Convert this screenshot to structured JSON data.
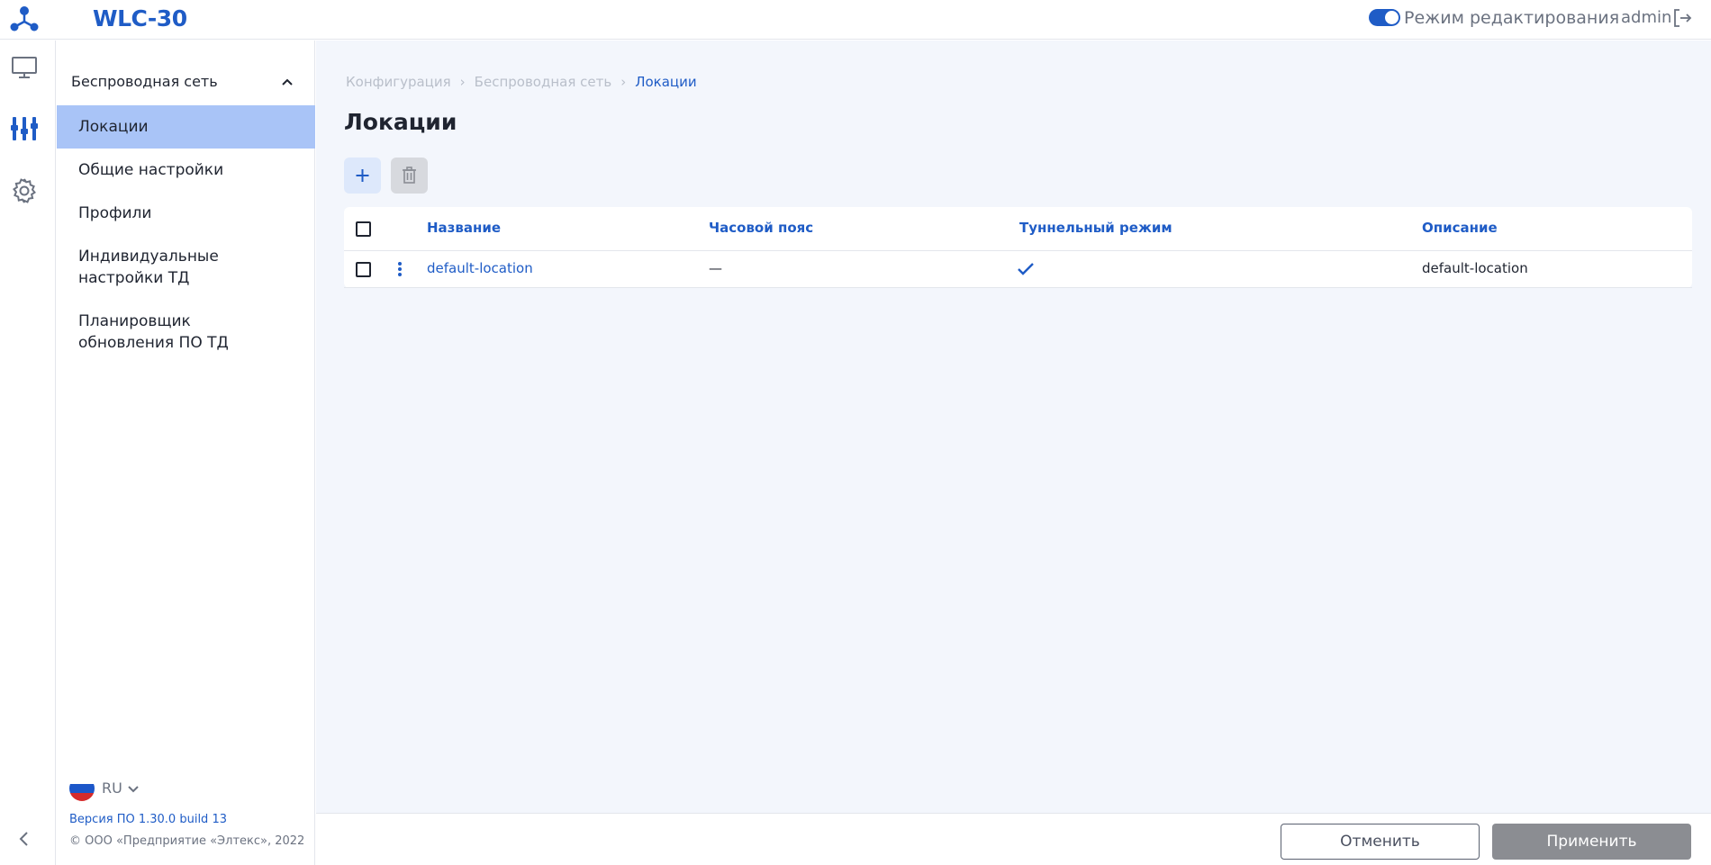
{
  "header": {
    "app_title": "WLC-30",
    "edit_mode_label": "Режим редактирования",
    "edit_mode_on": true,
    "user": "admin"
  },
  "rail": {
    "items": [
      {
        "icon": "monitor-icon"
      },
      {
        "icon": "configuration-sliders-icon",
        "active": true
      },
      {
        "icon": "gear-icon"
      }
    ]
  },
  "sidebar": {
    "section_title": "Беспроводная сеть",
    "items": [
      {
        "label": "Локации",
        "active": true
      },
      {
        "label": "Общие настройки"
      },
      {
        "label": "Профили"
      },
      {
        "label": "Индивидуальные настройки ТД"
      },
      {
        "label": "Планировщик обновления ПО ТД"
      }
    ],
    "language": "RU",
    "version": "Версия ПО 1.30.0 build 13",
    "copyright": "© ООО «Предприятие «Элтекс», 2022"
  },
  "breadcrumb": [
    "Конфигурация",
    "Беспроводная сеть",
    "Локации"
  ],
  "page_title": "Локации",
  "table": {
    "columns": [
      "Название",
      "Часовой пояс",
      "Туннельный режим",
      "Описание"
    ],
    "rows": [
      {
        "name": "default-location",
        "timezone": "—",
        "tunnel_mode": true,
        "description": "default-location"
      }
    ]
  },
  "footer": {
    "cancel_label": "Отменить",
    "apply_label": "Применить"
  },
  "colors": {
    "accent": "#1f5cc6",
    "active_nav": "#a9c4f7",
    "main_bg": "#f3f6fc",
    "apply_disabled": "#8b8d92"
  }
}
